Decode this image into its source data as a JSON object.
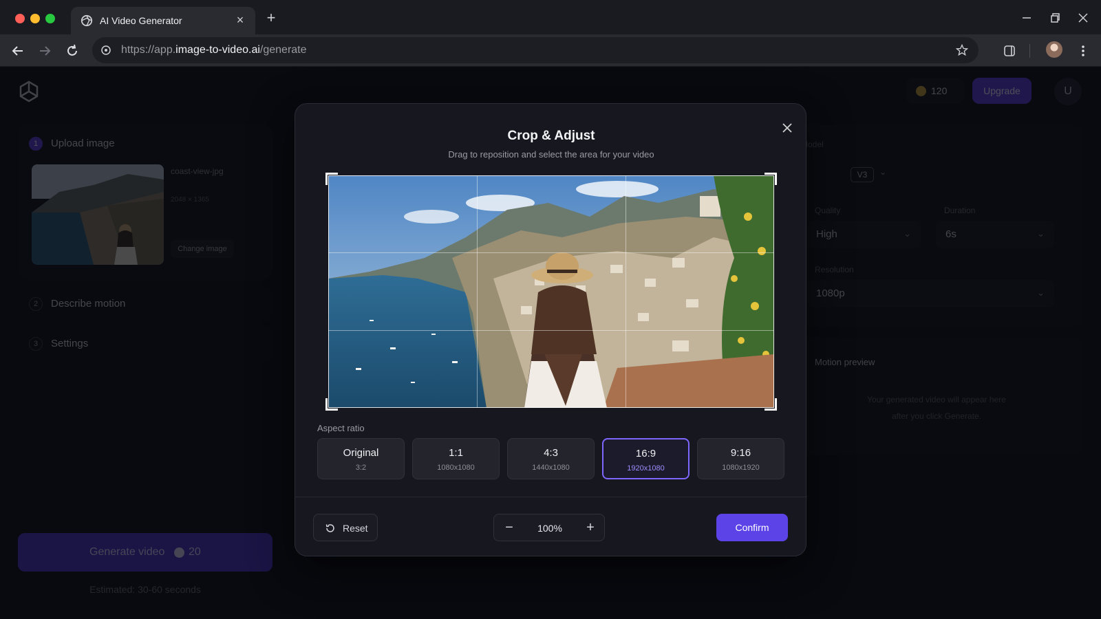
{
  "browser": {
    "tab_title": "AI Video Generator",
    "url_prefix": "https://app.",
    "url_host": "image-to-video.ai",
    "url_path": "/generate"
  },
  "app": {
    "credits": "120",
    "upgrade_label": "Upgrade",
    "user_initial": "U",
    "steps": [
      {
        "num": "1",
        "label": "Upload image"
      },
      {
        "num": "2",
        "label": "Describe motion"
      },
      {
        "num": "3",
        "label": "Settings"
      }
    ],
    "upload": {
      "file_name": "coast-view-jpg",
      "file_dims": "2048 × 1365",
      "change_label": "Change image"
    },
    "generate": {
      "label": "Generate video",
      "cost": "20",
      "estimate": "Estimated: 30-60 seconds"
    },
    "settings": {
      "model_label": "Model",
      "model_value": "V3",
      "quality_label": "Quality",
      "quality_value": "High",
      "duration_label": "Duration",
      "duration_value": "6s",
      "resolution_label": "Resolution",
      "resolution_value": "1080p"
    },
    "preview": {
      "title": "Motion preview",
      "line1": "Your generated video will appear here",
      "line2": "after you click Generate."
    }
  },
  "modal": {
    "title": "Crop & Adjust",
    "subtitle": "Drag to reposition and select the area for your video",
    "aspect_label": "Aspect ratio",
    "aspect_options": [
      {
        "name": "Original",
        "dims": "3:2",
        "selected": false
      },
      {
        "name": "1:1",
        "dims": "1080x1080",
        "selected": false
      },
      {
        "name": "4:3",
        "dims": "1440x1080",
        "selected": false
      },
      {
        "name": "16:9",
        "dims": "1920x1080",
        "selected": true
      },
      {
        "name": "9:16",
        "dims": "1080x1920",
        "selected": false
      }
    ],
    "reset_label": "Reset",
    "zoom_value": "100%",
    "zoom_minus": "−",
    "zoom_plus": "+",
    "confirm_label": "Confirm"
  },
  "colors": {
    "accent": "#5b43e8",
    "selected_border": "#7c67ff",
    "modal_bg": "#17181f"
  }
}
